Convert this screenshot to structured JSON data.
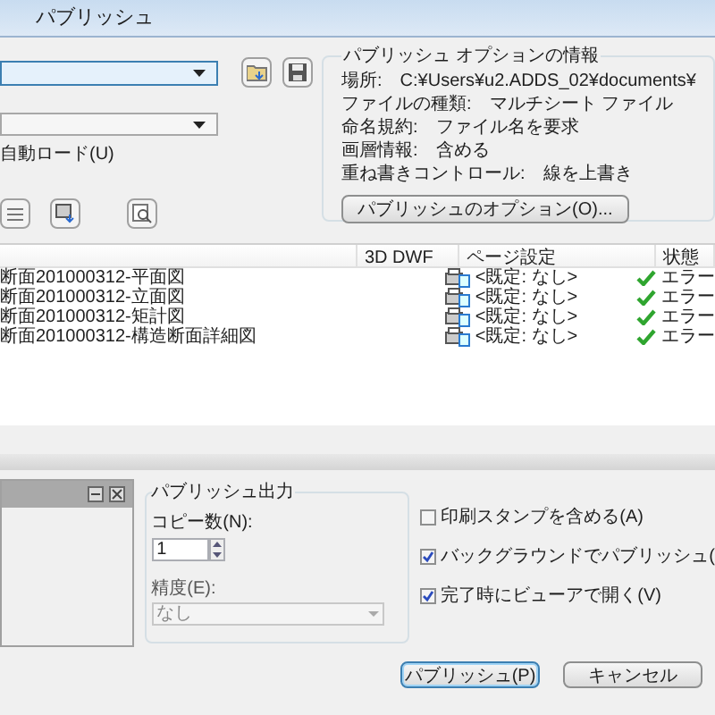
{
  "window": {
    "title": "パブリッシュ"
  },
  "auto_load": {
    "label": "自動ロード(U)"
  },
  "options_info": {
    "title": "パブリッシュ オプションの情報",
    "rows": [
      {
        "label": "場所:",
        "value": "C:¥Users¥u2.ADDS_02¥documents¥"
      },
      {
        "label": "ファイルの種類:",
        "value": "マルチシート ファイル"
      },
      {
        "label": "命名規約:",
        "value": "ファイル名を要求"
      },
      {
        "label": "画層情報:",
        "value": "含める"
      },
      {
        "label": "重ね書きコントロール:",
        "value": "線を上書き"
      }
    ],
    "button": "パブリッシュのオプション(O)..."
  },
  "table": {
    "columns": [
      "3D DWF",
      "ページ設定",
      "状態"
    ],
    "rows": [
      {
        "name": "断面201000312-平面図",
        "page_setup": "<既定: なし>",
        "status": "エラー"
      },
      {
        "name": "断面201000312-立面図",
        "page_setup": "<既定: なし>",
        "status": "エラー"
      },
      {
        "name": "断面201000312-矩計図",
        "page_setup": "<既定: なし>",
        "status": "エラー"
      },
      {
        "name": "断面201000312-構造断面詳細図",
        "page_setup": "<既定: なし>",
        "status": "エラー"
      }
    ]
  },
  "publish_output": {
    "title": "パブリッシュ出力",
    "copies_label": "コピー数(N):",
    "copies": "1",
    "precision_label": "精度(E):",
    "precision": "なし"
  },
  "checkboxes": [
    {
      "label": "印刷スタンプを含める(A)",
      "checked": false
    },
    {
      "label": "バックグラウンドでパブリッシュ(",
      "checked": true
    },
    {
      "label": "完了時にビューアで開く(V)",
      "checked": true
    }
  ],
  "buttons": [
    {
      "label": "パブリッシュ(P)",
      "selected": true
    },
    {
      "label": "キャンセル",
      "selected": false
    }
  ]
}
